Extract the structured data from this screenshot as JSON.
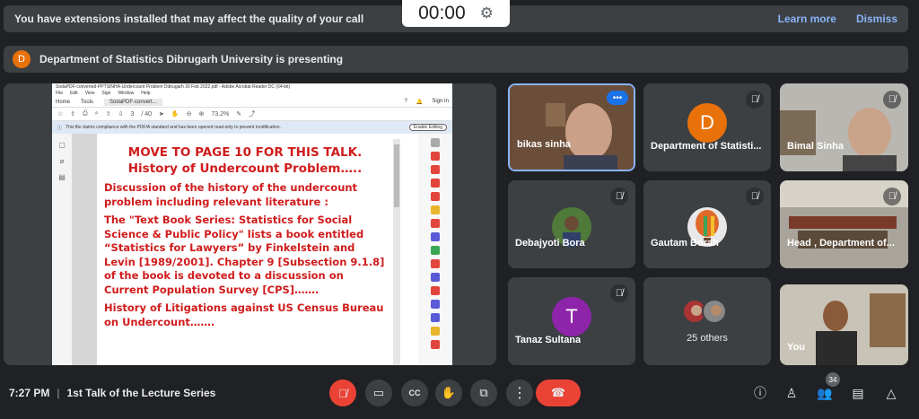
{
  "timer": {
    "value": "00:00"
  },
  "extension_banner": {
    "text": "You have extensions installed that may affect the quality of your call",
    "learn_more": "Learn more",
    "dismiss": "Dismiss"
  },
  "presenting_banner": {
    "avatar_letter": "D",
    "text": "Department of Statistics Dibrugarh University is presenting"
  },
  "pdf": {
    "title": "SodaPDF-converted-PPTSINHA-Undercount Problem Dibrugarh 20 Feb 2022.pdf - Adobe Acrobat Reader DC (64-bit)",
    "menu": [
      "File",
      "Edit",
      "View",
      "Sign",
      "Window",
      "Help"
    ],
    "tabs": {
      "home": "Home",
      "tools": "Tools",
      "doc": "SodaPDF-convert...",
      "sign_in": "Sign In"
    },
    "page_current": "3",
    "page_total": "/ 40",
    "zoom": "73.2%",
    "notice": "This file claims compliance with the PDF/A standard and has been opened read-only to prevent modification.",
    "enable_editing": "Enable Editing",
    "slide": {
      "heading1": "MOVE TO PAGE 10 FOR  THIS TALK.",
      "heading2": "History of Undercount Problem…..",
      "p1": "Discussion of the history of the undercount problem including relevant literature :",
      "p2": "The \"Text Book Series: Statistics for Social Science & Public Policy\" lists a book entitled “Statistics for Lawyers” by Finkelstein and Levin [1989/2001]. Chapter 9 [Subsection 9.1.8] of the book is devoted to a discussion on Current Population Survey [CPS]…….",
      "p3": "History of Litigations against US Census Bureau on Undercount……."
    }
  },
  "participants": [
    {
      "name": "bikas sinha"
    },
    {
      "name": "Department of Statisti...",
      "letter": "D",
      "color": "#e8710a"
    },
    {
      "name": "Bimal Sinha"
    },
    {
      "name": "Debajyoti Bora"
    },
    {
      "name": "Gautam Borah"
    },
    {
      "name": "Head , Department of..."
    },
    {
      "name": "Tanaz Sultana",
      "letter": "T",
      "color": "#8e24aa"
    },
    {
      "name": "25 others"
    },
    {
      "name": "You"
    }
  ],
  "bottom": {
    "time": "7:27 PM",
    "separator": "|",
    "meeting_title": "1st Talk of the Lecture Series",
    "people_count": "34"
  },
  "icons": {
    "mic": "mic-off-icon",
    "camera": "videocam-icon",
    "captions": "closed-captions-icon",
    "hand": "raise-hand-icon",
    "present": "present-screen-icon",
    "more": "more-vert-icon",
    "end": "call-end-icon",
    "info": "info-icon",
    "host": "host-controls-icon",
    "people": "people-icon",
    "chat": "chat-icon",
    "activities": "activities-icon"
  }
}
